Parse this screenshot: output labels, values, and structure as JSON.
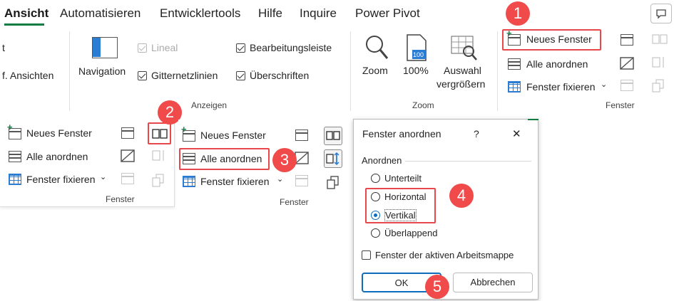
{
  "tabs": [
    "Ansicht",
    "Automatisieren",
    "Entwicklertools",
    "Hilfe",
    "Inquire",
    "Power Pivot"
  ],
  "ribbon": {
    "left_items": [
      "t",
      "f. Ansichten"
    ],
    "navigation": "Navigation",
    "lineal": "Lineal",
    "gitternetzlinien": "Gitternetzlinien",
    "bearbeitungsleiste": "Bearbeitungsleiste",
    "ueberschriften": "Überschriften",
    "group_anzeigen": "Anzeigen",
    "zoom": "Zoom",
    "zoom100": "100%",
    "zoom100_icon": "100",
    "auswahl1": "Auswahl",
    "auswahl2": "vergrößern",
    "group_zoom": "Zoom",
    "neues_fenster": "Neues Fenster",
    "alle_anordnen": "Alle anordnen",
    "fenster_fixieren": "Fenster fixieren",
    "group_fenster": "Fenster"
  },
  "panel2": {
    "neues_fenster": "Neues Fenster",
    "alle_anordnen": "Alle anordnen",
    "fenster_fixieren": "Fenster fixieren",
    "group": "Fenster"
  },
  "panel3": {
    "neues_fenster": "Neues Fenster",
    "alle_anordnen": "Alle anordnen",
    "fenster_fixieren": "Fenster fixieren",
    "group": "Fenster"
  },
  "dialog": {
    "title": "Fenster anordnen",
    "help": "?",
    "close": "✕",
    "section": "Anordnen",
    "options": [
      "Unterteilt",
      "Horizontal",
      "Vertikal",
      "Überlappend"
    ],
    "selected": "Vertikal",
    "checkbox": "Fenster der aktiven Arbeitsmappe",
    "ok": "OK",
    "cancel": "Abbrechen"
  },
  "badges": [
    "1",
    "2",
    "3",
    "4",
    "5"
  ],
  "colors": {
    "accent": "#107c41",
    "highlight": "#e8484b",
    "badge": "#f04a4a",
    "radio": "#0f6cbd"
  }
}
